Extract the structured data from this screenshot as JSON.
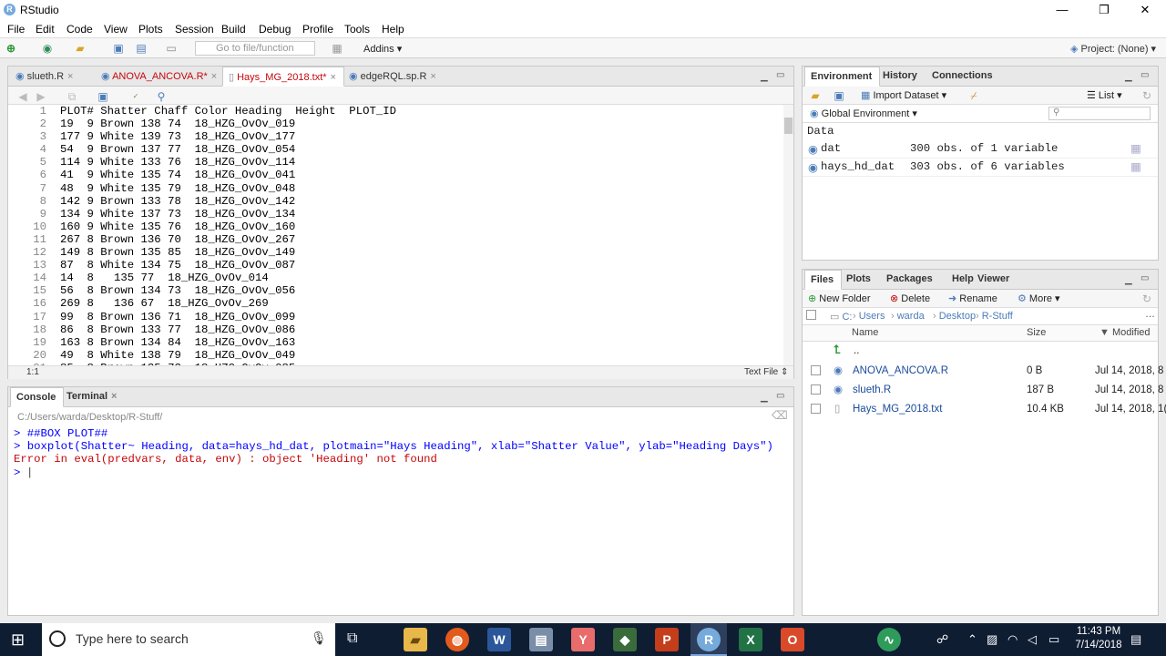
{
  "window": {
    "title": "RStudio",
    "minimize": "—",
    "restore": "❐",
    "close": "✕"
  },
  "menu": [
    "File",
    "Edit",
    "Code",
    "View",
    "Plots",
    "Session",
    "Build",
    "Debug",
    "Profile",
    "Tools",
    "Help"
  ],
  "toolbar": {
    "goto_placeholder": "Go to file/function",
    "addins": "Addins",
    "project": "Project: (None)"
  },
  "editor": {
    "tabs": [
      {
        "label": "slueth.R",
        "modified": false,
        "active": false
      },
      {
        "label": "ANOVA_ANCOVA.R*",
        "modified": true,
        "active": false
      },
      {
        "label": "Hays_MG_2018.txt*",
        "modified": true,
        "active": true
      },
      {
        "label": "edgeRQL.sp.R",
        "modified": false,
        "active": false
      }
    ],
    "lines": [
      {
        "n": "1",
        "text": "PLOT# Shatter Chaff Color Heading  Height  PLOT_ID"
      },
      {
        "n": "2",
        "text": "19  9 Brown 138 74  18_HZG_OvOv_019"
      },
      {
        "n": "3",
        "text": "177 9 White 139 73  18_HZG_OvOv_177"
      },
      {
        "n": "4",
        "text": "54  9 Brown 137 77  18_HZG_OvOv_054"
      },
      {
        "n": "5",
        "text": "114 9 White 133 76  18_HZG_OvOv_114"
      },
      {
        "n": "6",
        "text": "41  9 White 135 74  18_HZG_OvOv_041"
      },
      {
        "n": "7",
        "text": "48  9 White 135 79  18_HZG_OvOv_048"
      },
      {
        "n": "8",
        "text": "142 9 Brown 133 78  18_HZG_OvOv_142"
      },
      {
        "n": "9",
        "text": "134 9 White 137 73  18_HZG_OvOv_134"
      },
      {
        "n": "10",
        "text": "160 9 White 135 76  18_HZG_OvOv_160"
      },
      {
        "n": "11",
        "text": "267 8 Brown 136 70  18_HZG_OvOv_267"
      },
      {
        "n": "12",
        "text": "149 8 Brown 135 85  18_HZG_OvOv_149"
      },
      {
        "n": "13",
        "text": "87  8 White 134 75  18_HZG_OvOv_087"
      },
      {
        "n": "14",
        "text": "14  8   135 77  18_HZG_OvOv_014"
      },
      {
        "n": "15",
        "text": "56  8 Brown 134 73  18_HZG_OvOv_056"
      },
      {
        "n": "16",
        "text": "269 8   136 67  18_HZG_OvOv_269"
      },
      {
        "n": "17",
        "text": "99  8 Brown 136 71  18_HZG_OvOv_099"
      },
      {
        "n": "18",
        "text": "86  8 Brown 133 77  18_HZG_OvOv_086"
      },
      {
        "n": "19",
        "text": "163 8 Brown 134 84  18_HZG_OvOv_163"
      },
      {
        "n": "20",
        "text": "49  8 White 138 79  18_HZG_OvOv_049"
      },
      {
        "n": "21",
        "text": "85  8 Brown 135 73  18_HZG_OvOv_085"
      }
    ],
    "cursor_pos": "1:1",
    "file_type": "Text File"
  },
  "console": {
    "tabs": [
      "Console",
      "Terminal"
    ],
    "path": "C:/Users/warda/Desktop/R-Stuff/",
    "lines": [
      {
        "text": "> ##BOX PLOT##",
        "kind": "input"
      },
      {
        "text": "> boxplot(Shatter~ Heading, data=hays_hd_dat, plotmain=\"Hays Heading\", xlab=\"Shatter Value\", ylab=\"Heading Days\")",
        "kind": "input"
      },
      {
        "text": "Error in eval(predvars, data, env) : object 'Heading' not found",
        "kind": "error"
      },
      {
        "text": "> ",
        "kind": "prompt"
      }
    ]
  },
  "environment": {
    "tabs": [
      "Environment",
      "History",
      "Connections"
    ],
    "import_label": "Import Dataset",
    "list_label": "List",
    "scope": "Global Environment",
    "section": "Data",
    "rows": [
      {
        "name": "dat",
        "value": "300 obs. of 1 variable"
      },
      {
        "name": "hays_hd_dat",
        "value": "303 obs. of 6 variables"
      }
    ]
  },
  "files": {
    "tabs": [
      "Files",
      "Plots",
      "Packages",
      "Help",
      "Viewer"
    ],
    "actions": [
      "New Folder",
      "Delete",
      "Rename",
      "More"
    ],
    "breadcrumb": [
      "C:",
      "Users",
      "warda",
      "Desktop",
      "R-Stuff"
    ],
    "headers": [
      "Name",
      "Size",
      "Modified"
    ],
    "parent": "..",
    "rows": [
      {
        "name": "ANOVA_ANCOVA.R",
        "size": "0 B",
        "modified": "Jul 14, 2018, 8"
      },
      {
        "name": "slueth.R",
        "size": "187 B",
        "modified": "Jul 14, 2018, 8"
      },
      {
        "name": "Hays_MG_2018.txt",
        "size": "10.4 KB",
        "modified": "Jul 14, 2018, 1("
      }
    ]
  },
  "taskbar": {
    "search": "Type here to search",
    "time": "11:43 PM",
    "date": "7/14/2018"
  },
  "colors": {
    "accent": "#4c7cb8",
    "error": "#c5060b",
    "console_input": "#0000ff",
    "taskbar": "#0f1d33"
  }
}
